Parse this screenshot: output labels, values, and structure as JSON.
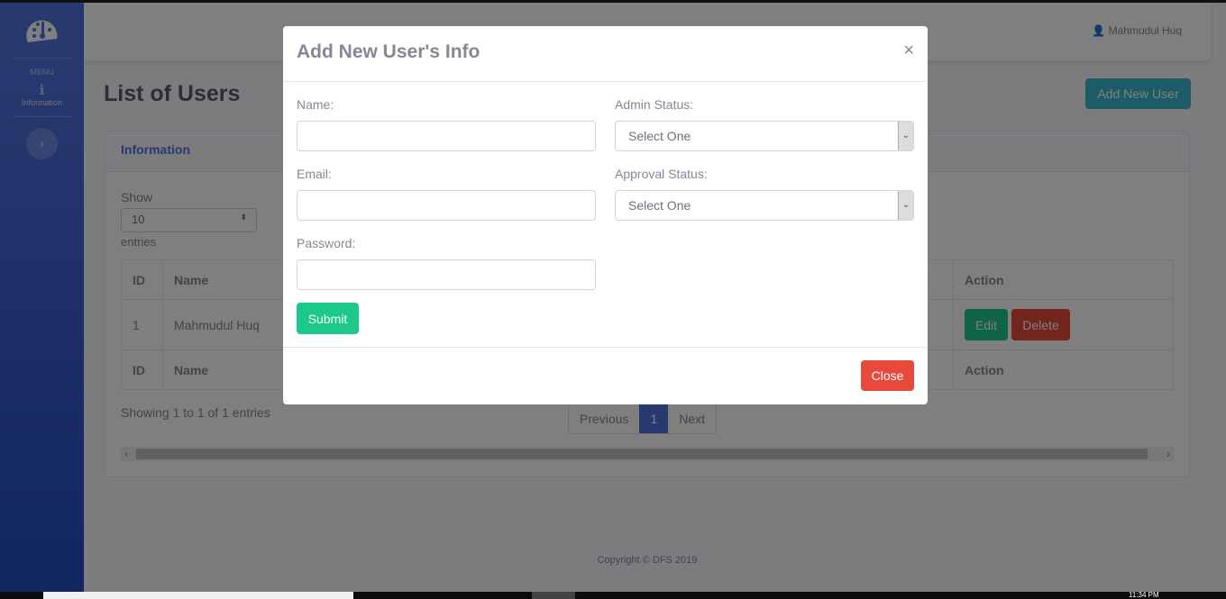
{
  "sidebar": {
    "menu_label": "MENU",
    "items": [
      {
        "label": "Information",
        "icon": "info-icon"
      }
    ],
    "toggle_icon": "chevron-right-icon"
  },
  "topbar": {
    "user_name": "Mahmudul Huq",
    "user_icon": "user-icon"
  },
  "page": {
    "title": "List of Users",
    "add_button": "Add New User"
  },
  "card": {
    "title": "Information",
    "show_label": "Show",
    "page_size": "10",
    "entries_label": "entries",
    "columns": [
      "ID",
      "Name",
      "Action"
    ],
    "rows": [
      {
        "id": "1",
        "name": "Mahmudul Huq",
        "edit": "Edit",
        "delete": "Delete"
      }
    ],
    "showing": "Showing 1 to 1 of 1 entries",
    "pagination": {
      "previous": "Previous",
      "current": "1",
      "next": "Next"
    }
  },
  "footer": {
    "copyright": "Copyright © DFS 2019"
  },
  "taskbar": {
    "time": "11:34 PM"
  },
  "modal": {
    "title": "Add New User's Info",
    "close_x": "×",
    "name_label": "Name:",
    "email_label": "Email:",
    "password_label": "Password:",
    "admin_label": "Admin Status:",
    "admin_value": "Select One",
    "approval_label": "Approval Status:",
    "approval_value": "Select One",
    "submit": "Submit",
    "close": "Close"
  },
  "colors": {
    "primary": "#4e73df",
    "info": "#36b9cc",
    "success": "#1cc88a",
    "danger": "#e74a3b"
  }
}
